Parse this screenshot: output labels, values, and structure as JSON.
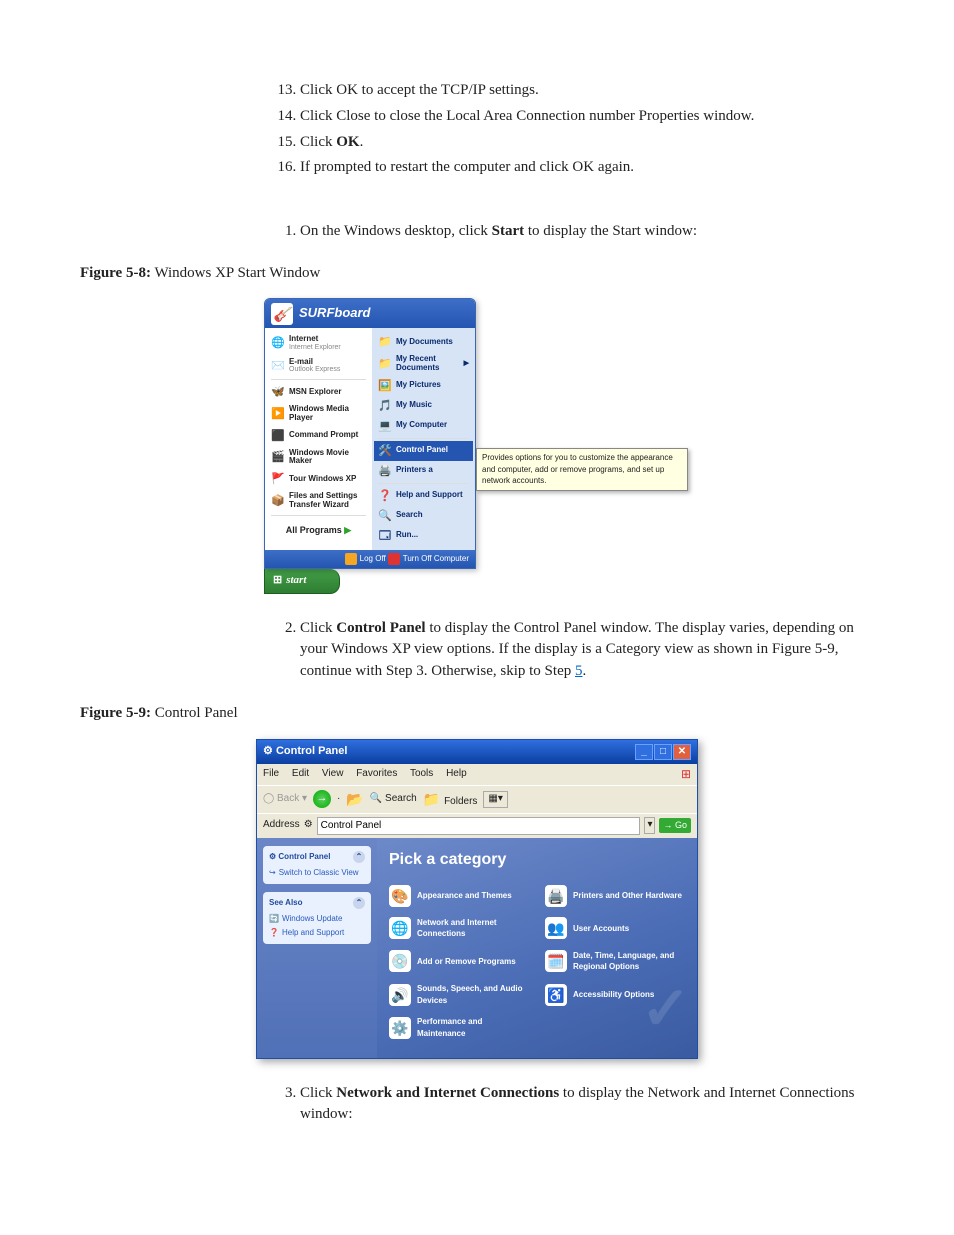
{
  "steps_a": {
    "start": 13,
    "items": [
      {
        "pre": "Click OK to accept the TCP/IP settings."
      },
      {
        "pre": "Click Close to close the Local Area Connection number Properties window."
      },
      {
        "pre": "Click ",
        "b": "OK",
        "post": "."
      },
      {
        "pre": "If prompted to restart the computer and click OK again."
      }
    ]
  },
  "steps_b": {
    "start": 1,
    "items": [
      {
        "pre": "On the Windows desktop, click ",
        "b": "Start",
        "post": " to display the Start window:"
      }
    ]
  },
  "fig1": {
    "label": "Figure 5-8:",
    "title": " Windows XP Start Window"
  },
  "startmenu": {
    "header": "SURFboard",
    "left": [
      {
        "icon": "🌐",
        "title": "Internet",
        "sub": "Internet Explorer"
      },
      {
        "icon": "✉️",
        "title": "E-mail",
        "sub": "Outlook Express"
      },
      {
        "icon": "🦋",
        "title": "MSN Explorer"
      },
      {
        "icon": "▶️",
        "title": "Windows Media Player"
      },
      {
        "icon": "⬛",
        "title": "Command Prompt"
      },
      {
        "icon": "🎬",
        "title": "Windows Movie Maker"
      },
      {
        "icon": "🚩",
        "title": "Tour Windows XP"
      },
      {
        "icon": "📦",
        "title": "Files and Settings Transfer Wizard"
      }
    ],
    "all": "All Programs",
    "right": [
      {
        "icon": "📁",
        "title": "My Documents"
      },
      {
        "icon": "📁",
        "title": "My Recent Documents",
        "arrow": true
      },
      {
        "icon": "🖼️",
        "title": "My Pictures"
      },
      {
        "icon": "🎵",
        "title": "My Music"
      },
      {
        "icon": "💻",
        "title": "My Computer"
      },
      {
        "icon": "🛠️",
        "title": "Control Panel",
        "sel": true
      },
      {
        "icon": "🖨️",
        "title": "Printers a"
      },
      {
        "icon": "❓",
        "title": "Help and Support"
      },
      {
        "icon": "🔍",
        "title": "Search"
      },
      {
        "icon": "🗔",
        "title": "Run..."
      }
    ],
    "logoff": "Log Off",
    "turnoff": "Turn Off Computer",
    "startbtn": "start",
    "tooltip": "Provides options for you to customize the appearance and computer, add or remove programs, and set up network accounts."
  },
  "steps_c": {
    "start": 2,
    "items": [
      {
        "pre": "Click ",
        "b": "Control Panel",
        "post": " to display the Control Panel window. The display varies, depending on your Windows XP view options. If the display is a Category view as shown in Figure 5-9, continue with Step 3. Otherwise, skip to Step ",
        "link": "5",
        "tail": "."
      }
    ]
  },
  "fig2": {
    "label": "Figure 5-9:",
    "title": " Control Panel"
  },
  "cp": {
    "title": "Control Panel",
    "menu": [
      "File",
      "Edit",
      "View",
      "Favorites",
      "Tools",
      "Help"
    ],
    "tool_back": "Back",
    "tool_search": "Search",
    "tool_folders": "Folders",
    "addr_label": "Address",
    "addr_value": "Control Panel",
    "go": "Go",
    "side1": {
      "hd": "Control Panel",
      "link": "Switch to Classic View"
    },
    "side2": {
      "hd": "See Also",
      "links": [
        "Windows Update",
        "Help and Support"
      ]
    },
    "heading": "Pick a category",
    "cats": [
      {
        "icon": "🎨",
        "t": "Appearance and Themes"
      },
      {
        "icon": "🖨️",
        "t": "Printers and Other Hardware"
      },
      {
        "icon": "🌐",
        "t": "Network and Internet Connections"
      },
      {
        "icon": "👥",
        "t": "User Accounts"
      },
      {
        "icon": "💿",
        "t": "Add or Remove Programs"
      },
      {
        "icon": "🗓️",
        "t": "Date, Time, Language, and Regional Options"
      },
      {
        "icon": "🔊",
        "t": "Sounds, Speech, and Audio Devices"
      },
      {
        "icon": "♿",
        "t": "Accessibility Options"
      },
      {
        "icon": "⚙️",
        "t": "Performance and Maintenance"
      }
    ]
  },
  "steps_d": {
    "start": 3,
    "items": [
      {
        "pre": "Click ",
        "b": "Network and Internet Connections",
        "post": " to display the Network and Internet Connections window:"
      }
    ]
  }
}
